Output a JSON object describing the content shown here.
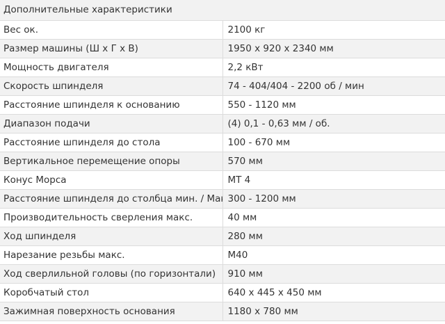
{
  "table": {
    "header": "Дополнительные характеристики",
    "rows": [
      {
        "label": "Вес ок.",
        "value": "2100 кг"
      },
      {
        "label": "Размер машины (Ш х Г х В)",
        "value": "1950 x 920 x 2340 мм"
      },
      {
        "label": "Мощность двигателя",
        "value": "2,2 кВт"
      },
      {
        "label": "Скорость шпинделя",
        "value": "74 - 404/404 - 2200 об / мин"
      },
      {
        "label": "Расстояние шпинделя к основанию",
        "value": "550 - 1120 мм"
      },
      {
        "label": "Диапазон подачи",
        "value": "(4) 0,1 - 0,63 мм / об."
      },
      {
        "label": "Расстояние шпинделя до стола",
        "value": "100 - 670 мм"
      },
      {
        "label": "Вертикальное перемещение опоры",
        "value": "570 мм"
      },
      {
        "label": "Конус Морса",
        "value": "MT 4"
      },
      {
        "label": "Расстояние шпинделя до столбца мин. / Макс.",
        "value": "300 - 1200 мм"
      },
      {
        "label": "Производительность сверления макс.",
        "value": "40 мм"
      },
      {
        "label": "Ход шпинделя",
        "value": "280 мм"
      },
      {
        "label": "Нарезание резьбы макс.",
        "value": "M40"
      },
      {
        "label": "Ход сверлильной головы (по горизонтали)",
        "value": "910 мм"
      },
      {
        "label": "Коробчатый стол",
        "value": "640 x 445 x 450 мм"
      },
      {
        "label": "Зажимная поверхность основания",
        "value": "1180 x 780 мм"
      }
    ]
  }
}
